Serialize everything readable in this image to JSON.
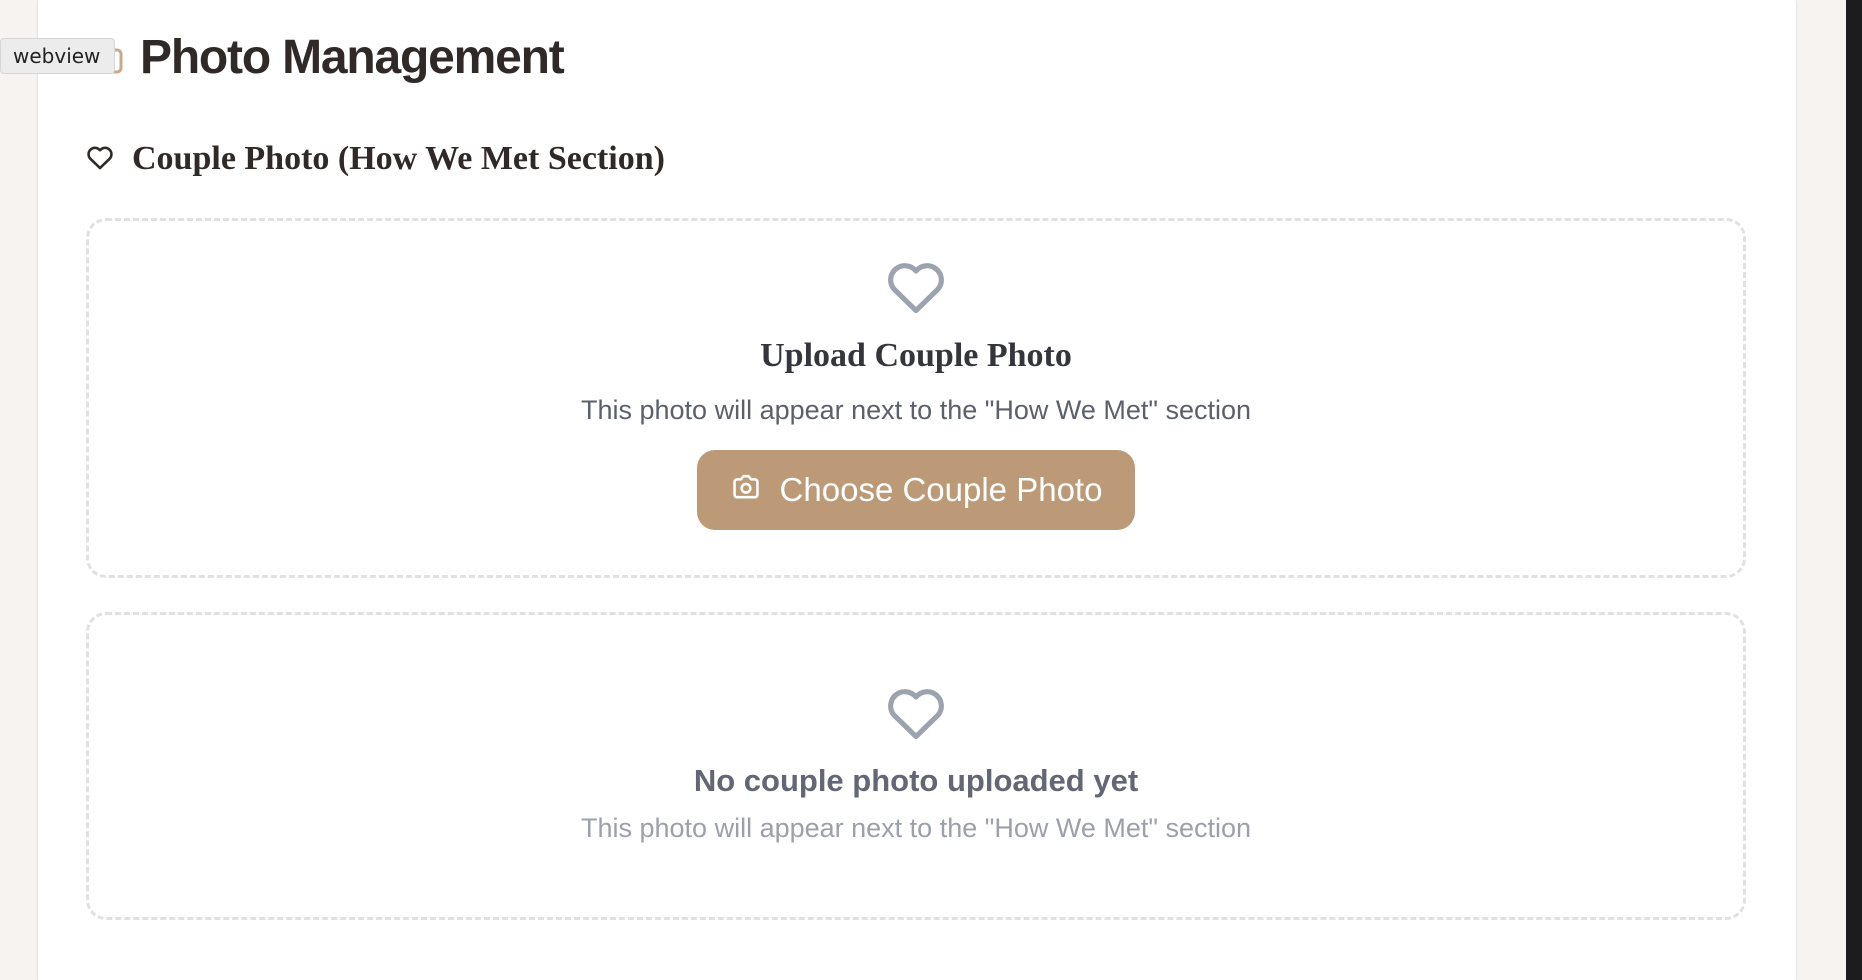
{
  "webview_label": "webview",
  "header": {
    "title": "Photo Management",
    "icon": "folder-icon"
  },
  "section": {
    "title": "Couple Photo (How We Met Section)",
    "icon": "heart-icon"
  },
  "upload": {
    "icon": "heart-icon",
    "title": "Upload Couple Photo",
    "description": "This photo will appear next to the \"How We Met\" section",
    "button_label": "Choose Couple Photo",
    "button_icon": "camera-icon"
  },
  "empty_state": {
    "icon": "heart-icon",
    "title": "No couple photo uploaded yet",
    "description": "This photo will appear next to the \"How We Met\" section"
  },
  "colors": {
    "accent": "#bc9a77",
    "title_text": "#2f2a27",
    "muted_icon": "#9ca3af",
    "page_background": "#f7f3f1"
  }
}
